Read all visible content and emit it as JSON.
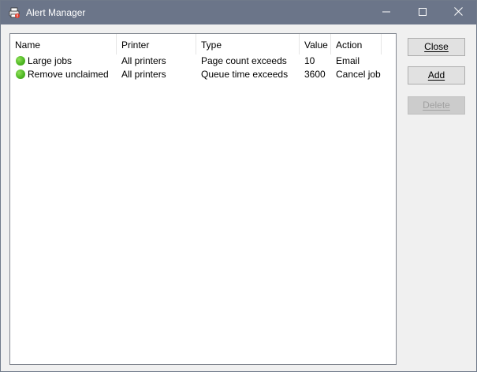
{
  "window": {
    "title": "Alert Manager",
    "titlebar_color": "#6b7589"
  },
  "list": {
    "columns": [
      "Name",
      "Printer",
      "Type",
      "Value",
      "Action"
    ],
    "rows": [
      {
        "status": "active",
        "name": "Large jobs",
        "printer": "All printers",
        "type": "Page count exceeds",
        "value": "10",
        "action": "Email"
      },
      {
        "status": "active",
        "name": "Remove unclaimed",
        "printer": "All printers",
        "type": "Queue time exceeds",
        "value": "3600",
        "action": "Cancel job"
      }
    ],
    "status_color": "#4fb824"
  },
  "buttons": {
    "close_label": "Close",
    "add_label": "Add",
    "delete_label": "Delete",
    "delete_enabled": false
  },
  "icons": {
    "app": "printer-alert-icon",
    "minimize": "minimize-icon",
    "maximize": "maximize-icon",
    "close": "close-icon",
    "status": "status-dot-icon"
  }
}
